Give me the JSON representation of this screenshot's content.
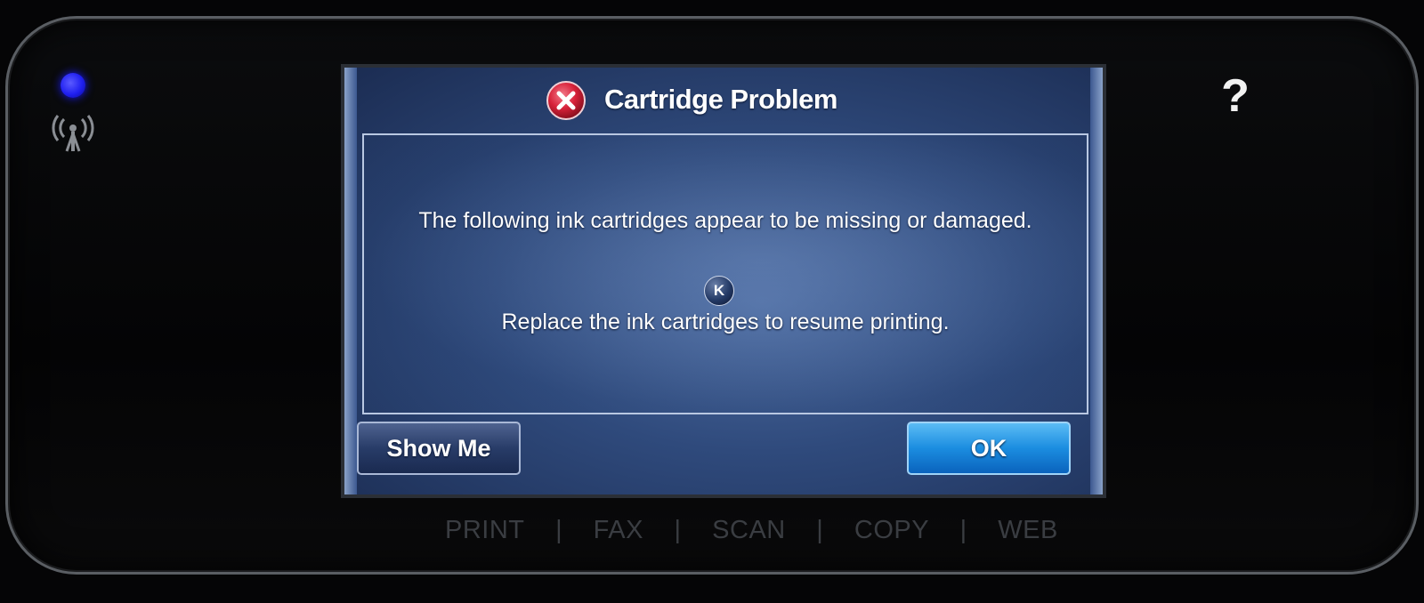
{
  "device": {
    "help_label": "?",
    "status_led_color": "#1f1ff0",
    "wireless_icon": "wireless-antenna-icon"
  },
  "dialog": {
    "icon": "error-x-icon",
    "title": "Cartridge Problem",
    "message_line1": "The following ink cartridges appear to be missing or damaged.",
    "cartridge_badge": "K",
    "message_line2": "Replace the ink cartridges to resume printing.",
    "buttons": {
      "show_me": "Show Me",
      "ok": "OK"
    }
  },
  "mode_bar": {
    "items": [
      "PRINT",
      "FAX",
      "SCAN",
      "COPY",
      "WEB"
    ],
    "separator": "|"
  },
  "colors": {
    "error_red": "#d8223a",
    "ok_button": "#1b8de0",
    "screen_bg": "#2f4a7c"
  }
}
